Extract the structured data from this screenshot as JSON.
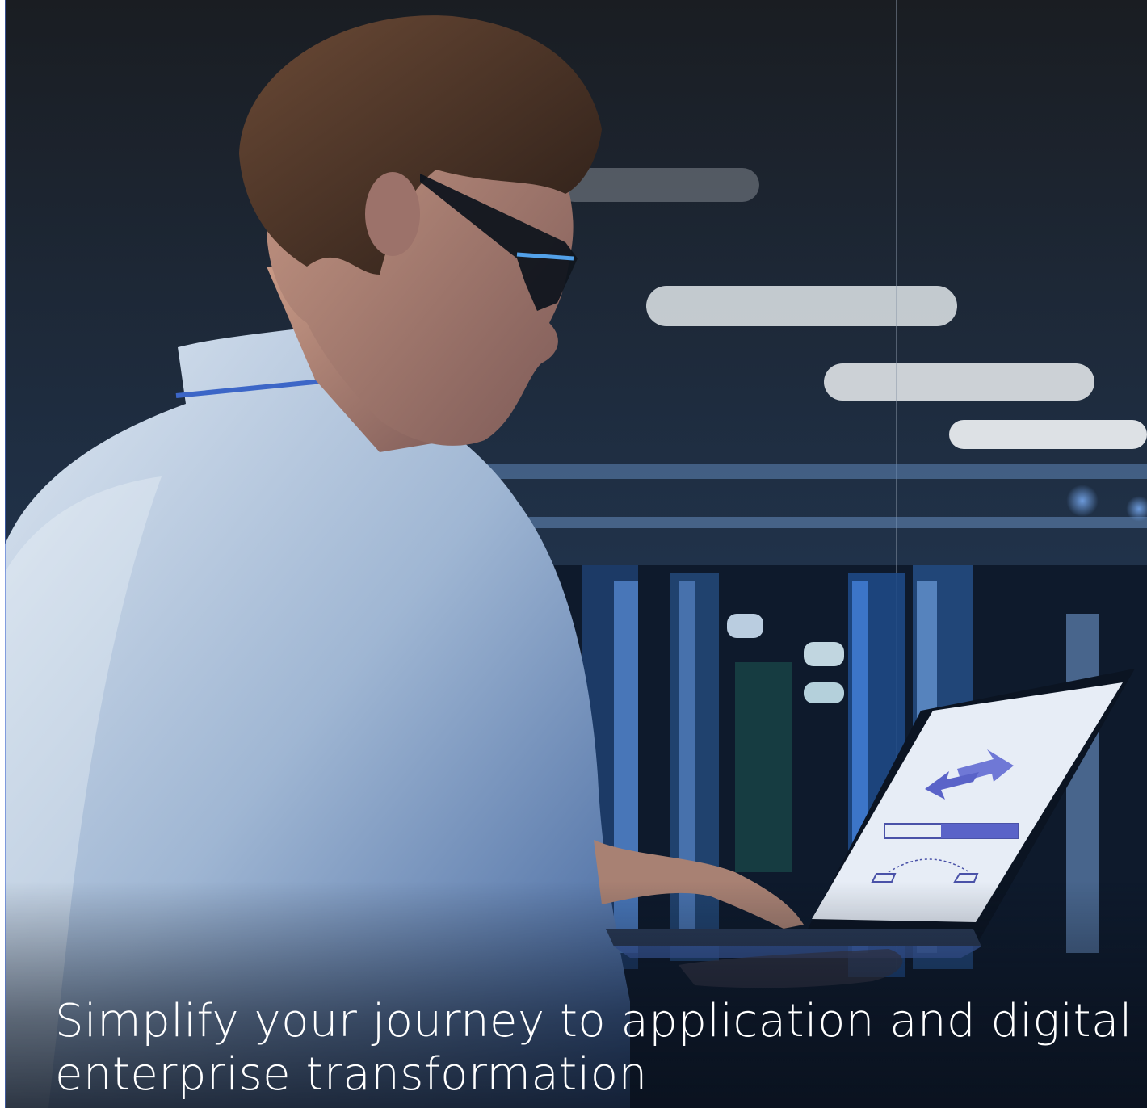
{
  "hero": {
    "headline_line1": "Simplify your journey to application and digital",
    "headline_line2": "enterprise transformation",
    "image_description_icons": [
      "transfer-arrows-icon",
      "progress-bar",
      "folder-transfer-icon"
    ],
    "colors": {
      "accent": "#5a63c8",
      "background": "#0f1d33",
      "text": "#ffffff",
      "screen": "#e9eef6"
    }
  }
}
